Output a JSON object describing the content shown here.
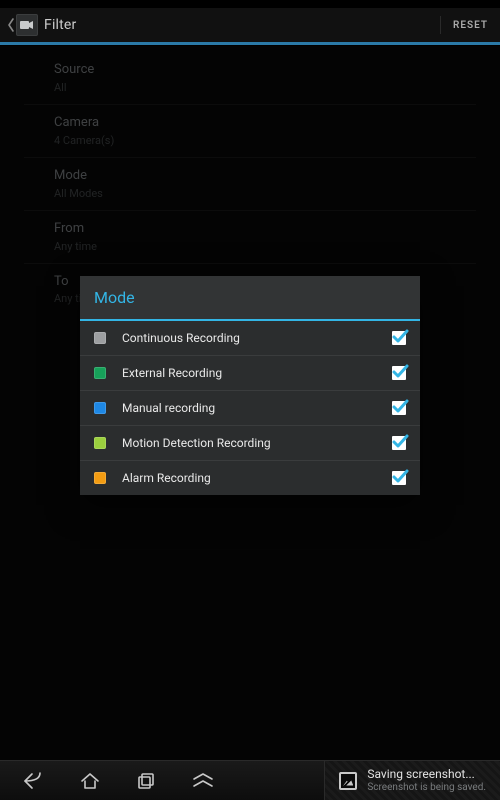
{
  "header": {
    "title": "Filter",
    "reset_label": "RESET"
  },
  "filters": [
    {
      "label": "Source",
      "value": "All"
    },
    {
      "label": "Camera",
      "value": "4 Camera(s)"
    },
    {
      "label": "Mode",
      "value": "All Modes"
    },
    {
      "label": "From",
      "value": "Any time"
    },
    {
      "label": "To",
      "value": "Any time"
    }
  ],
  "dialog": {
    "title": "Mode",
    "items": [
      {
        "label": "Continuous Recording",
        "color": "#9d9fa1",
        "checked": true
      },
      {
        "label": "External Recording",
        "color": "#17a15a",
        "checked": true
      },
      {
        "label": "Manual recording",
        "color": "#1e88e5",
        "checked": true
      },
      {
        "label": "Motion Detection Recording",
        "color": "#9bcf3e",
        "checked": true
      },
      {
        "label": "Alarm Recording",
        "color": "#f39c12",
        "checked": true
      }
    ]
  },
  "toast": {
    "title": "Saving screenshot...",
    "subtitle": "Screenshot is being saved."
  }
}
